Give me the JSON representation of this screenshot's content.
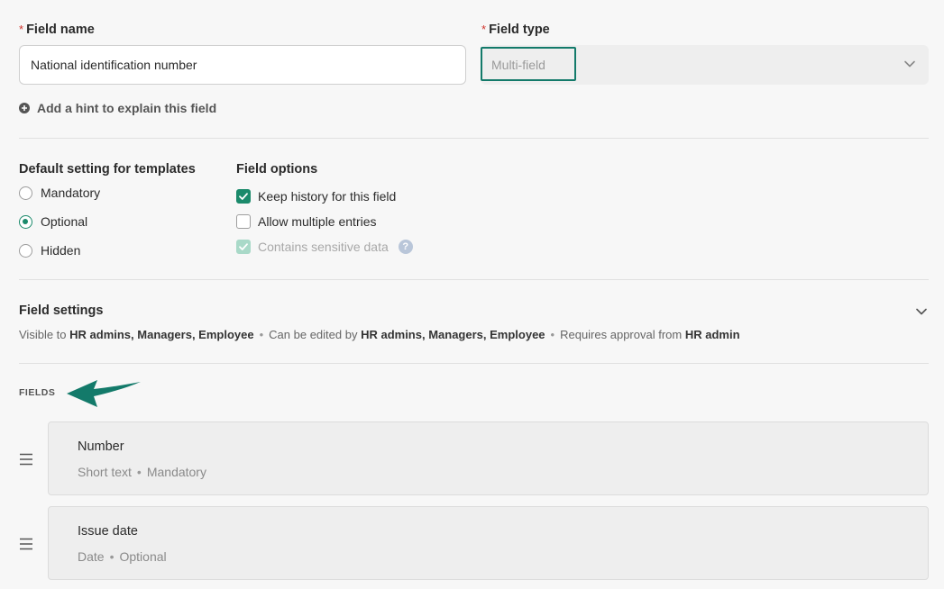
{
  "field_name": {
    "required_marker": "*",
    "label": "Field name",
    "value": "National identification number"
  },
  "field_type": {
    "required_marker": "*",
    "label": "Field type",
    "value": "Multi-field"
  },
  "hint_link": "Add a hint to explain this field",
  "default_setting": {
    "title": "Default setting for templates",
    "options": [
      "Mandatory",
      "Optional",
      "Hidden"
    ],
    "selected": "Optional"
  },
  "field_options": {
    "title": "Field options",
    "items": [
      {
        "label": "Keep history for this field",
        "checked": true,
        "disabled": false
      },
      {
        "label": "Allow multiple entries",
        "checked": false,
        "disabled": false
      },
      {
        "label": "Contains sensitive data",
        "checked": true,
        "disabled": true
      }
    ],
    "help_glyph": "?"
  },
  "field_settings": {
    "title": "Field settings",
    "visible_prefix": "Visible to",
    "visible_to": "HR admins, Managers, Employee",
    "edit_prefix": "Can be edited by",
    "editable_by": "HR admins, Managers, Employee",
    "approval_prefix": "Requires approval from",
    "approval_from": "HR admin",
    "separator": "•"
  },
  "fields_section": {
    "label": "FIELDS",
    "items": [
      {
        "name": "Number",
        "type": "Short text",
        "requirement": "Mandatory"
      },
      {
        "name": "Issue date",
        "type": "Date",
        "requirement": "Optional"
      }
    ]
  },
  "colors": {
    "accent": "#1b8a6b",
    "highlight_border": "#137a6a",
    "arrow": "#137a6a",
    "required": "#d0342c"
  },
  "icons": {
    "hint": "plus-circle-icon",
    "select": "chevron-down-icon",
    "settings": "chevron-down-icon",
    "annotation": "arrow-icon",
    "drag": "drag-handle-icon",
    "help": "help-icon"
  }
}
